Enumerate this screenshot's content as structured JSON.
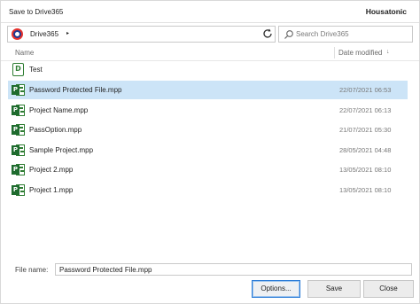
{
  "window": {
    "title": "Save to Drive365",
    "brand": "Housatonic"
  },
  "address": {
    "location": "Drive365",
    "chevron": "▸"
  },
  "search": {
    "placeholder": "Search Drive365"
  },
  "columns": {
    "name": "Name",
    "date": "Date modified",
    "sort_indicator": "↓"
  },
  "items": [
    {
      "type": "folder",
      "icon": "folder-d-icon",
      "glyph": "D",
      "name": "Test",
      "date": ""
    },
    {
      "type": "file",
      "icon": "project-file-icon",
      "name": "Password Protected File.mpp",
      "date": "22/07/2021 06:53",
      "selected": true
    },
    {
      "type": "file",
      "icon": "project-file-icon",
      "name": "Project Name.mpp",
      "date": "22/07/2021 06:13"
    },
    {
      "type": "file",
      "icon": "project-file-icon",
      "name": "PassOption.mpp",
      "date": "21/07/2021 05:30"
    },
    {
      "type": "file",
      "icon": "project-file-icon",
      "name": "Sample Project.mpp",
      "date": "28/05/2021 04:48"
    },
    {
      "type": "file",
      "icon": "project-file-icon",
      "name": "Project 2.mpp",
      "date": "13/05/2021 08:10"
    },
    {
      "type": "file",
      "icon": "project-file-icon",
      "name": "Project 1.mpp",
      "date": "13/05/2021 08:10"
    }
  ],
  "file_name": {
    "label": "File name:",
    "value": "Password Protected File.mpp"
  },
  "buttons": {
    "options": "Options...",
    "save": "Save",
    "close": "Close"
  },
  "colors": {
    "selection": "#cce4f7",
    "project_green": "#1e6b2e",
    "focus_border": "#2b7bd6"
  }
}
